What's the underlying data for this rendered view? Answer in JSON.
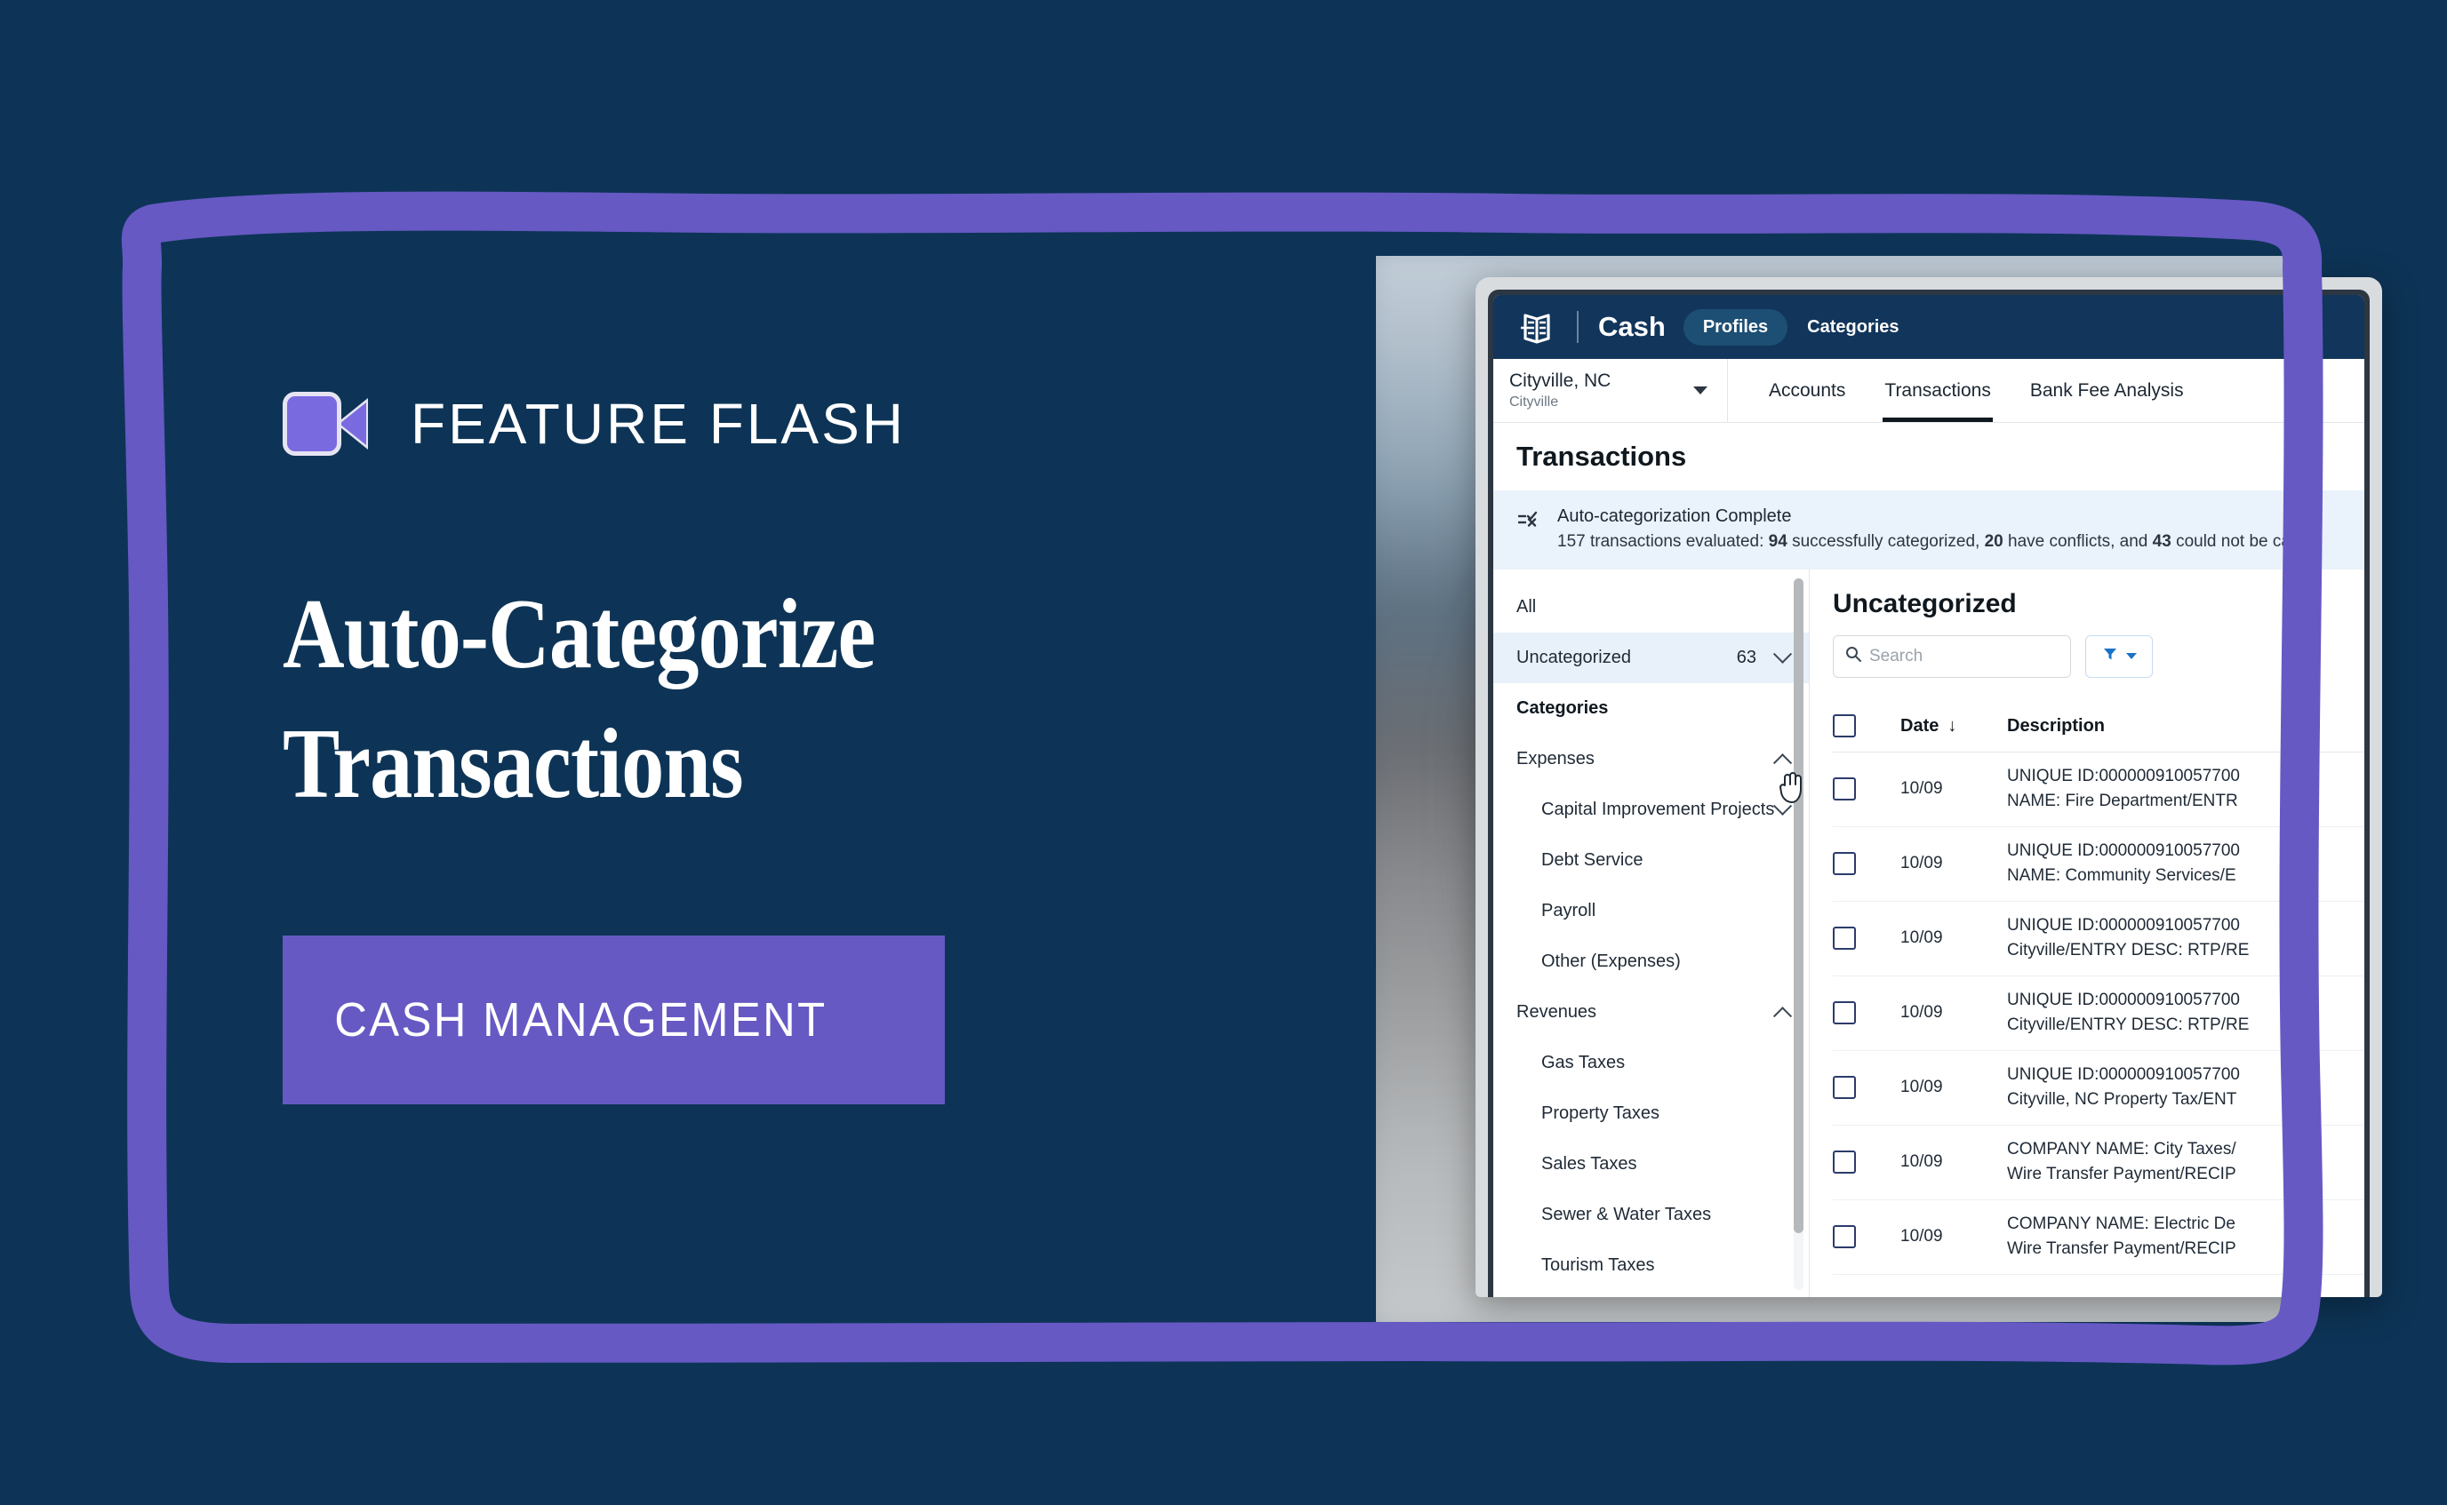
{
  "promo": {
    "brand_label": "FEATURE FLASH",
    "brand_icon": "video-camera-icon",
    "headline_line1": "Auto-Categorize",
    "headline_line2": "Transactions",
    "cta_label": "CASH MANAGEMENT",
    "accent_purple": "#6659c4",
    "background_navy": "#0d3456"
  },
  "app": {
    "topbar": {
      "logo_icon": "ledger-book-icon",
      "product_name": "Cash",
      "nav": [
        {
          "label": "Profiles",
          "active": true
        },
        {
          "label": "Categories",
          "active": false
        }
      ]
    },
    "subbar": {
      "profile": {
        "name": "Cityville, NC",
        "sub": "Cityville",
        "icon": "chevron-down-icon"
      },
      "tabs": [
        {
          "label": "Accounts",
          "active": false
        },
        {
          "label": "Transactions",
          "active": true
        },
        {
          "label": "Bank Fee Analysis",
          "active": false
        }
      ]
    },
    "page_title": "Transactions",
    "banner": {
      "icon": "auto-categorize-icon",
      "title": "Auto-categorization Complete",
      "prefix": "157 transactions evaluated: ",
      "n_success": "94",
      "mid1": " successfully categorized, ",
      "n_conflicts": "20",
      "mid2": " have conflicts, and ",
      "n_failed": "43",
      "suffix": " could not be ca"
    },
    "categories_panel": {
      "all_label": "All",
      "uncategorized": {
        "label": "Uncategorized",
        "count": "63",
        "icon": "chevron-down-icon"
      },
      "section_header": "Categories",
      "groups": [
        {
          "label": "Expenses",
          "icon": "chevron-up-icon",
          "items": [
            {
              "label": "Capital Improvement Projects",
              "icon": "chevron-down-icon"
            },
            {
              "label": "Debt Service",
              "icon": ""
            },
            {
              "label": "Payroll",
              "icon": ""
            },
            {
              "label": "Other (Expenses)",
              "icon": ""
            }
          ]
        },
        {
          "label": "Revenues",
          "icon": "chevron-up-icon",
          "items": [
            {
              "label": "Gas Taxes",
              "icon": ""
            },
            {
              "label": "Property Taxes",
              "icon": ""
            },
            {
              "label": "Sales Taxes",
              "icon": ""
            },
            {
              "label": "Sewer & Water Taxes",
              "icon": ""
            },
            {
              "label": "Tourism Taxes",
              "icon": ""
            }
          ]
        }
      ]
    },
    "transactions_panel": {
      "title": "Uncategorized",
      "search_placeholder": "Search",
      "search_value": "",
      "search_icon": "search-icon",
      "clear_icon": "close-icon",
      "filter_icon": "filter-icon",
      "filter_caret_icon": "caret-down-icon",
      "columns": {
        "select": "",
        "date": "Date",
        "description": "Description",
        "sort_icon": "arrow-down-icon"
      },
      "rows": [
        {
          "date": "10/09",
          "desc_line1": "UNIQUE ID:000000910057700",
          "desc_line2": "NAME: Fire Department/ENTR"
        },
        {
          "date": "10/09",
          "desc_line1": "UNIQUE ID:000000910057700",
          "desc_line2": "NAME: Community Services/E"
        },
        {
          "date": "10/09",
          "desc_line1": "UNIQUE ID:000000910057700",
          "desc_line2": "Cityville/ENTRY DESC: RTP/RE"
        },
        {
          "date": "10/09",
          "desc_line1": "UNIQUE ID:000000910057700",
          "desc_line2": "Cityville/ENTRY DESC: RTP/RE"
        },
        {
          "date": "10/09",
          "desc_line1": "UNIQUE ID:000000910057700",
          "desc_line2": "Cityville, NC Property Tax/ENT"
        },
        {
          "date": "10/09",
          "desc_line1": "COMPANY NAME: City Taxes/",
          "desc_line2": "Wire Transfer Payment/RECIP"
        },
        {
          "date": "10/09",
          "desc_line1": "COMPANY NAME: Electric De",
          "desc_line2": "Wire Transfer Payment/RECIP"
        }
      ]
    }
  }
}
